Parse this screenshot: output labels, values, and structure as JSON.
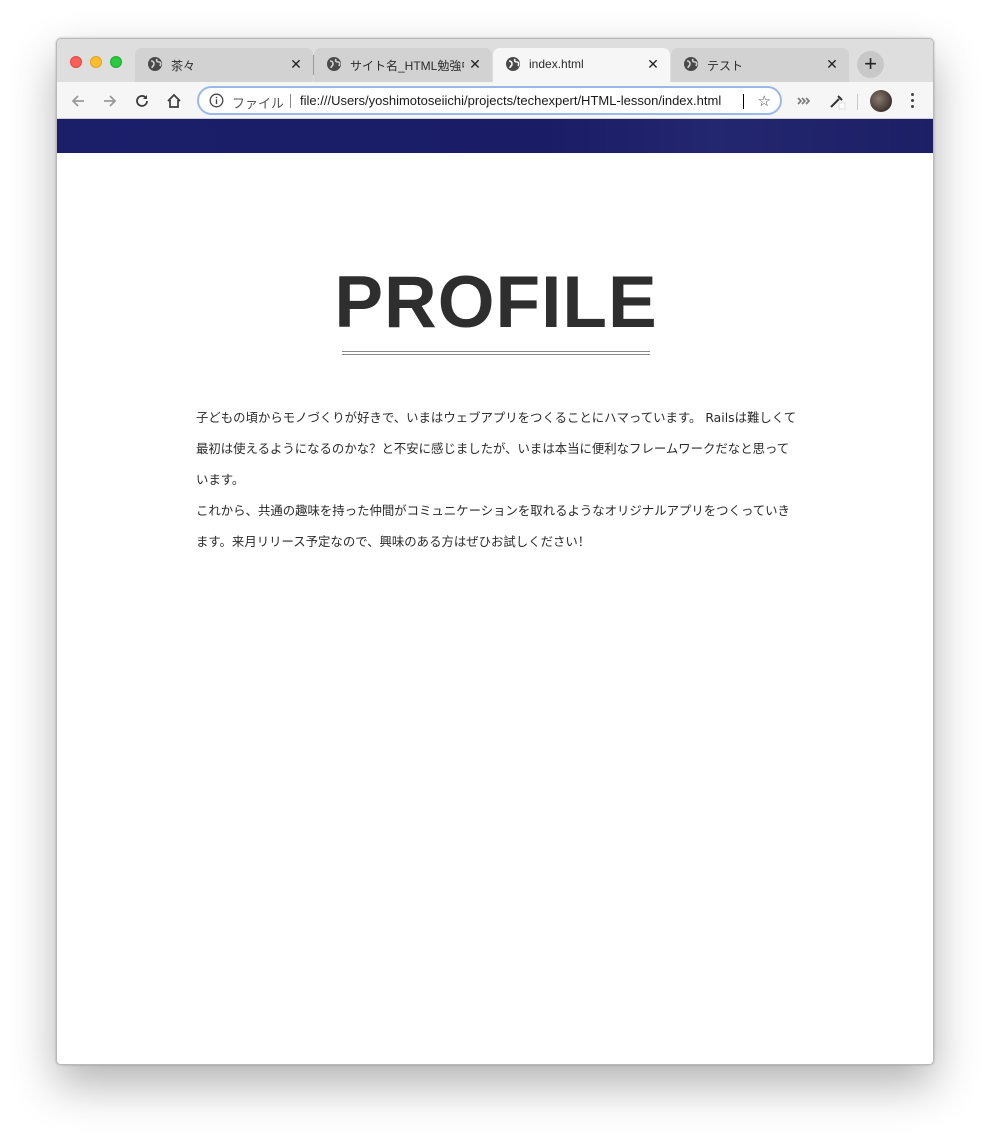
{
  "browser": {
    "tabs": [
      {
        "title": "茶々",
        "close": "✕",
        "icon": "globe-icon"
      },
      {
        "title": "サイト名_HTML勉強中",
        "close": "✕",
        "icon": "globe-icon"
      },
      {
        "title": "index.html",
        "close": "✕",
        "icon": "globe-icon",
        "active": true
      },
      {
        "title": "テスト",
        "close": "✕",
        "icon": "globe-icon"
      }
    ],
    "new_tab_label": "+",
    "address_bar": {
      "scheme_label": "ファイル",
      "url": "file:///Users/yoshimotoseiichi/projects/techexpert/HTML-lesson/index.html",
      "bookmark_icon": "☆"
    },
    "colors": {
      "banner": "#1b1f6a",
      "tabstrip": "#dedede",
      "toolbar": "#f6f6f6",
      "focus_ring": "#9bb8e8"
    }
  },
  "page": {
    "heading": "PROFILE",
    "paragraphs": [
      "子どもの頃からモノづくりが好きで、いまはウェブアプリをつくることにハマっています。 Railsは難しくて最初は使えるようになるのかな？と不安に感じましたが、いまは本当に便利なフレームワークだなと思っています。",
      "これから、共通の趣味を持った仲間がコミュニケーションを取れるようなオリジナルアプリをつくっていきます。来月リリース予定なので、興味のある方はぜひお試しください！"
    ]
  }
}
